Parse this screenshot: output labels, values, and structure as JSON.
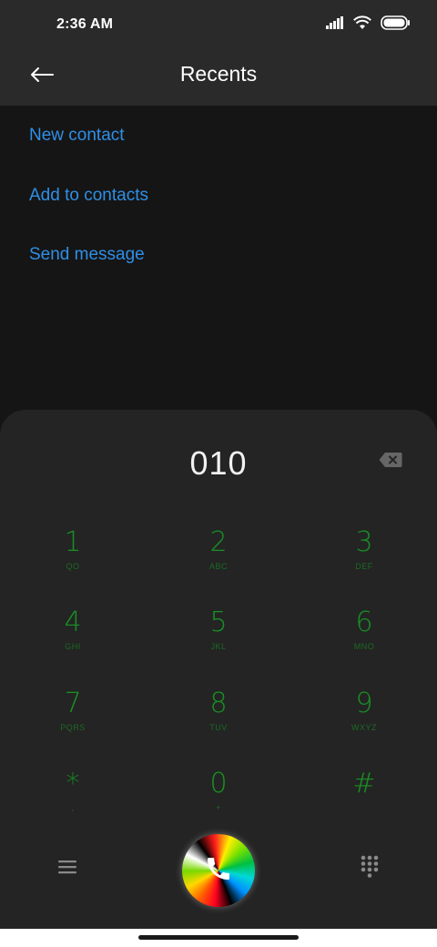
{
  "status_bar": {
    "time": "2:36 AM",
    "icons": [
      "signal-icon",
      "wifi-icon",
      "battery-icon"
    ]
  },
  "header": {
    "title": "Recents",
    "back_icon": "arrow-left-icon"
  },
  "actions": [
    {
      "label": "New contact"
    },
    {
      "label": "Add to contacts"
    },
    {
      "label": "Send message"
    }
  ],
  "dialpad": {
    "number": "010",
    "backspace_icon": "backspace-icon",
    "keys": [
      {
        "digit": "1",
        "letters": "QO"
      },
      {
        "digit": "2",
        "letters": "ABC"
      },
      {
        "digit": "3",
        "letters": "DEF"
      },
      {
        "digit": "4",
        "letters": "GHI"
      },
      {
        "digit": "5",
        "letters": "JKL"
      },
      {
        "digit": "6",
        "letters": "MNO"
      },
      {
        "digit": "7",
        "letters": "PQRS"
      },
      {
        "digit": "8",
        "letters": "TUV"
      },
      {
        "digit": "9",
        "letters": "WXYZ"
      },
      {
        "digit": "*",
        "letters": ","
      },
      {
        "digit": "0",
        "letters": "+"
      },
      {
        "digit": "#",
        "letters": ""
      }
    ],
    "digit_color": "#1f8a2a"
  },
  "bottom_bar": {
    "menu_icon": "menu-icon",
    "call_icon": "phone-icon",
    "keypad_icon": "dialpad-grid-icon"
  },
  "colors": {
    "link": "#2f8fe6",
    "panel": "#242424",
    "header": "#2a2a2a",
    "background": "#151515"
  }
}
